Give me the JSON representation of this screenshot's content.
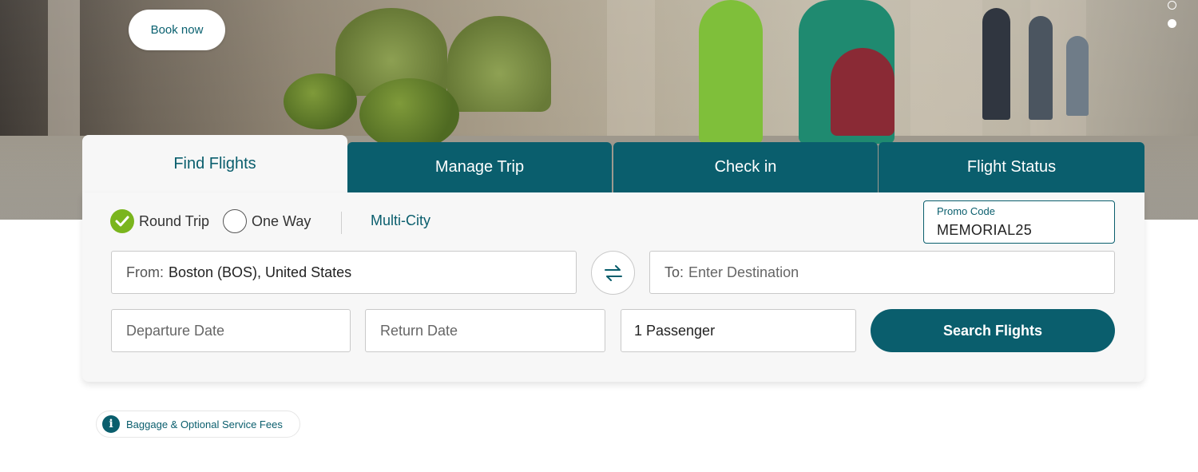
{
  "hero": {
    "book_now_label": "Book now"
  },
  "carousel": {
    "indicators": [
      "slide-1",
      "slide-2"
    ]
  },
  "tabs": [
    {
      "label": "Find Flights",
      "active": true
    },
    {
      "label": "Manage Trip",
      "active": false
    },
    {
      "label": "Check in",
      "active": false
    },
    {
      "label": "Flight Status",
      "active": false
    }
  ],
  "trip_type": {
    "round_trip": "Round Trip",
    "one_way": "One Way",
    "multi_city": "Multi-City",
    "selected": "Round Trip"
  },
  "promo": {
    "label": "Promo Code",
    "value": "MEMORIAL25"
  },
  "from": {
    "prefix": "From:",
    "value": "Boston (BOS), United States"
  },
  "to": {
    "prefix": "To:",
    "placeholder": "Enter Destination"
  },
  "departure": {
    "placeholder": "Departure Date"
  },
  "return_date": {
    "placeholder": "Return Date"
  },
  "passengers": {
    "value": "1 Passenger"
  },
  "search": {
    "label": "Search Flights"
  },
  "baggage": {
    "label": "Baggage & Optional Service Fees"
  },
  "colors": {
    "brand_teal": "#0a5e6d",
    "check_green": "#7ab51d"
  }
}
